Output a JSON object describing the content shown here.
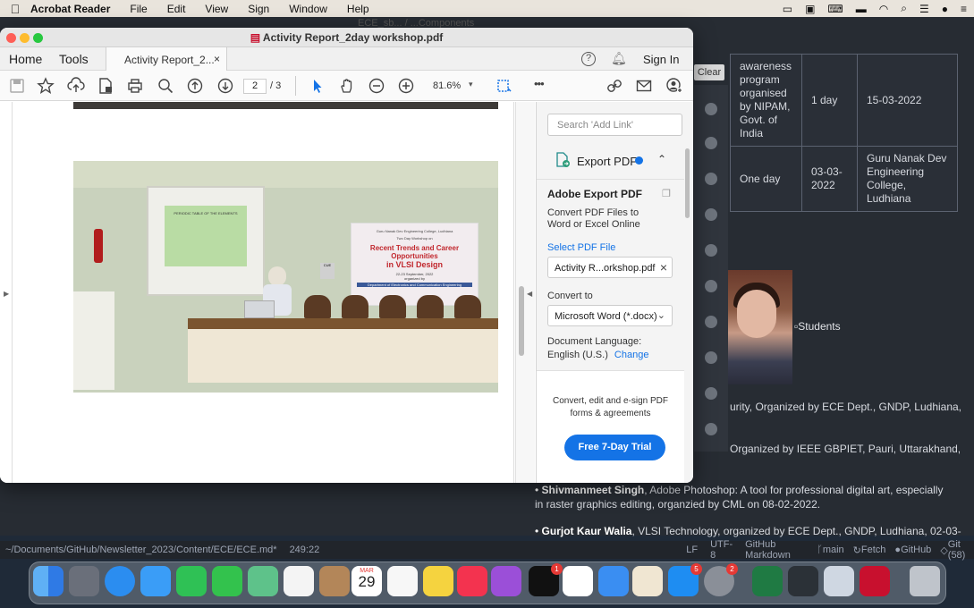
{
  "menubar": {
    "apple": "",
    "app": "Acrobat Reader",
    "menus": [
      "File",
      "Edit",
      "View",
      "Sign",
      "Window",
      "Help"
    ],
    "bg_title_fragment": "ECE_sb... / ...Components"
  },
  "window": {
    "title": "Activity Report_2day workshop.pdf",
    "nav_home": "Home",
    "nav_tools": "Tools",
    "tab_label": "Activity Report_2...",
    "tab_close": "×",
    "help": "?",
    "sign_in": "Sign In"
  },
  "toolbar": {
    "page_current": "2",
    "page_total": "/ 3",
    "zoom": "81.6%",
    "more": "•••"
  },
  "banner": {
    "college": "Guru Nanak Dev Engineering College, Ludhiana",
    "event": "Two Day Workshop on",
    "heading1": "Recent Trends and Career Opportunities",
    "heading2": "in VLSI Design",
    "dates": "22-23 September, 2022",
    "org": "organized by",
    "dept": "Department of Electronics and Communication Engineering",
    "screen_title": "PERIODIC TABLE OF THE ELEMENTS",
    "cue": "CUE"
  },
  "panel": {
    "search_placeholder": "Search 'Add Link'",
    "export_header": "Export PDF",
    "title": "Adobe Export PDF",
    "desc": "Convert PDF Files to Word or Excel Online",
    "select_label": "Select PDF File",
    "file_name": "Activity R...orkshop.pdf",
    "convert_to": "Convert to",
    "format": "Microsoft Word (*.docx)",
    "lang_label": "Document Language:",
    "lang_value": "English (U.S.)",
    "lang_change": "Change",
    "promo": "Convert, edit and e-sign PDF forms & agreements",
    "trial": "Free 7-Day Trial"
  },
  "background": {
    "clear": "Clear",
    "row1": [
      "awareness program organised by NIPAM, Govt. of India",
      "1 day",
      "15-03-2022"
    ],
    "row2": [
      "One day",
      "03-03-2022",
      "Guru Nanak Dev Engineering College, Ludhiana"
    ],
    "students_alt": "Students",
    "line1": "urity, Organized by ECE Dept., GNDP, Ludhiana,",
    "line2": "Organized by IEEE GBPIET, Pauri, Uttarakhand,",
    "bullet1_name": "Shivmanmeet Singh",
    "bullet1_text": ", Adobe Photoshop: A tool for professional digital art, especially in raster graphics editing, organzied by CML on 08-02-2022.",
    "bullet2_name": "Gurjot Kaur Walia",
    "bullet2_text": ", VLSI Technology, organized by ECE Dept., GNDP, Ludhiana, 02-03-"
  },
  "statusbar": {
    "path": "~/Documents/GitHub/Newsletter_2023/Content/ECE/ECE.md*",
    "position": "249:22",
    "eol": "LF",
    "encoding": "UTF-8",
    "grammar": "GitHub Markdown",
    "branch": "main",
    "fetch": "Fetch",
    "github": "GitHub",
    "git": "Git (58)"
  },
  "dock": {
    "calendar_month": "MAR",
    "calendar_day": "29",
    "badge_tv": "1",
    "badge_appstore": "5",
    "badge_prefs": "2"
  },
  "colors": {
    "accent": "#1473e6",
    "trial_button": "#1473e6"
  }
}
